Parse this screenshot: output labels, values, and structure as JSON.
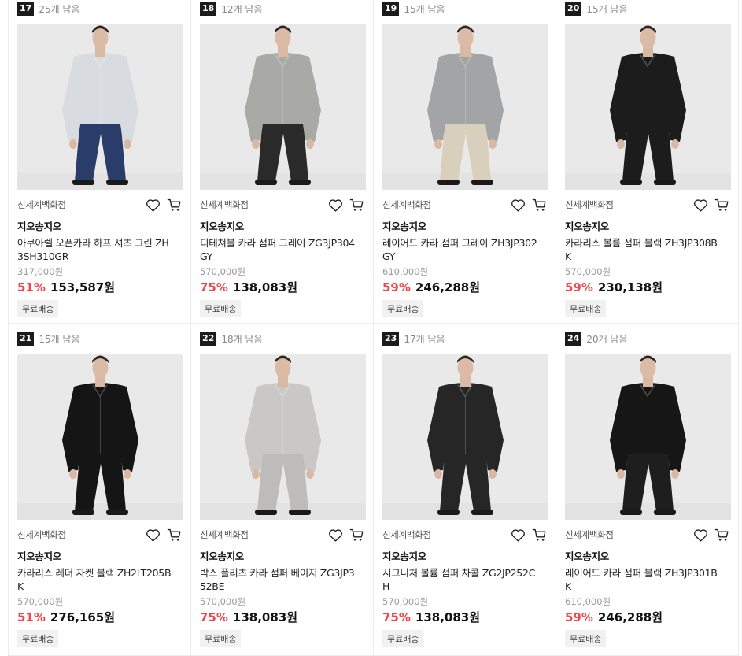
{
  "products": [
    {
      "rank": "17",
      "stock": "25개 남음",
      "store": "신세계백화점",
      "brand": "지오송지오",
      "name": "아쿠아렐 오픈카라 하프 셔츠 그린 ZH3SH310GR",
      "original_price": "317,000원",
      "discount": "51%",
      "price": "153,587원",
      "shipping": "무료배송",
      "colors": {
        "top": "#d8dce0",
        "bottom": "#2a3c6a"
      }
    },
    {
      "rank": "18",
      "stock": "12개 남음",
      "store": "신세계백화점",
      "brand": "지오송지오",
      "name": "디테쳐블 카라 점퍼 그레이 ZG3JP304GY",
      "original_price": "570,000원",
      "discount": "75%",
      "price": "138,083원",
      "shipping": "무료배송",
      "colors": {
        "top": "#a9a9a6",
        "bottom": "#2a2a2a"
      }
    },
    {
      "rank": "19",
      "stock": "15개 남음",
      "store": "신세계백화점",
      "brand": "지오송지오",
      "name": "레이어드 카라 점퍼 그레이 ZH3JP302GY",
      "original_price": "610,000원",
      "discount": "59%",
      "price": "246,288원",
      "shipping": "무료배송",
      "colors": {
        "top": "#a2a4a6",
        "bottom": "#d9cfbd"
      }
    },
    {
      "rank": "20",
      "stock": "15개 남음",
      "store": "신세계백화점",
      "brand": "지오송지오",
      "name": "카라리스 볼륨 점퍼 블랙 ZH3JP308BK",
      "original_price": "570,000원",
      "discount": "59%",
      "price": "230,138원",
      "shipping": "무료배송",
      "colors": {
        "top": "#1c1c1c",
        "bottom": "#1c1c1c"
      }
    },
    {
      "rank": "21",
      "stock": "15개 남음",
      "store": "신세계백화점",
      "brand": "지오송지오",
      "name": "카라리스 레더 자켓 블랙 ZH2LT205BK",
      "original_price": "570,000원",
      "discount": "51%",
      "price": "276,165원",
      "shipping": "무료배송",
      "colors": {
        "top": "#151515",
        "bottom": "#151515"
      }
    },
    {
      "rank": "22",
      "stock": "18개 남음",
      "store": "신세계백화점",
      "brand": "지오송지오",
      "name": "박스 플리츠 카라 점퍼 베이지 ZG3JP352BE",
      "original_price": "570,000원",
      "discount": "75%",
      "price": "138,083원",
      "shipping": "무료배송",
      "colors": {
        "top": "#c9c8c6",
        "bottom": "#bdbcba"
      }
    },
    {
      "rank": "23",
      "stock": "17개 남음",
      "store": "신세계백화점",
      "brand": "지오송지오",
      "name": "시그니처 볼륨 점퍼 차콜 ZG2JP252CH",
      "original_price": "570,000원",
      "discount": "75%",
      "price": "138,083원",
      "shipping": "무료배송",
      "colors": {
        "top": "#262626",
        "bottom": "#262626"
      }
    },
    {
      "rank": "24",
      "stock": "20개 남음",
      "store": "신세계백화점",
      "brand": "지오송지오",
      "name": "레이어드 카라 점퍼 블랙 ZH3JP301BK",
      "original_price": "610,000원",
      "discount": "59%",
      "price": "246,288원",
      "shipping": "무료배송",
      "colors": {
        "top": "#161616",
        "bottom": "#1e1e1e"
      }
    }
  ],
  "icons": {
    "wishlist": "heart-icon",
    "cart": "cart-icon"
  },
  "theme": {
    "discount_color": "#f0464c",
    "rank_badge_bg": "#1b1b1b"
  }
}
